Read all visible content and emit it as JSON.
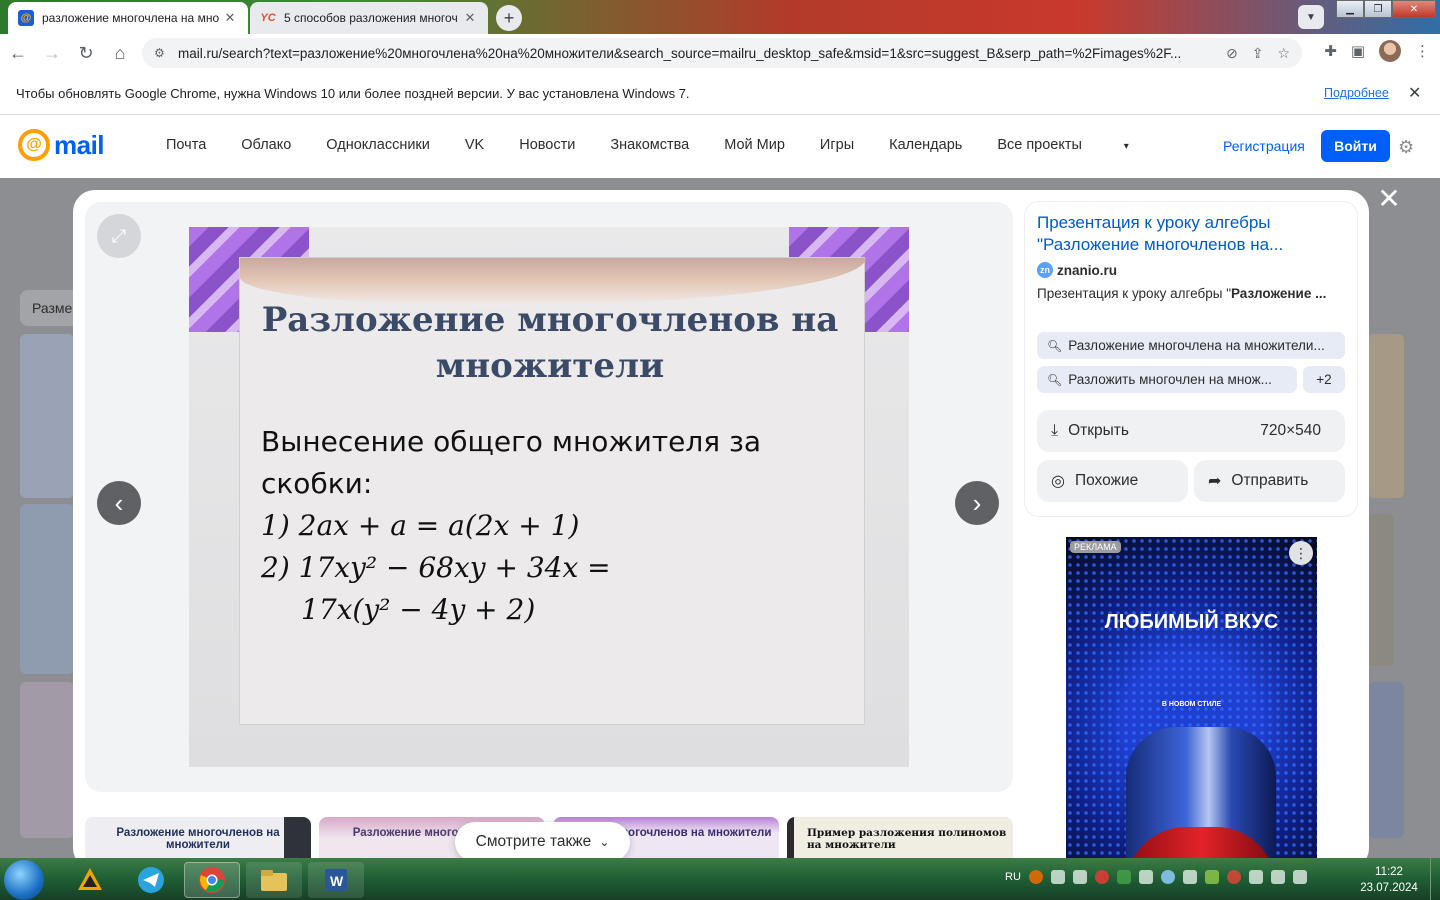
{
  "browser": {
    "tabs": [
      {
        "title": "разложение многочлена на мно",
        "icon": "mailru-at-icon",
        "active": true
      },
      {
        "title": "5 способов разложения многоч",
        "icon": "yaklass-icon",
        "active": false
      }
    ],
    "new_tab": "+",
    "url": "mail.ru/search?text=разложение%20многочлена%20на%20множители&search_source=mailru_desktop_safe&msid=1&src=suggest_B&serp_path=%2Fimages%2F...",
    "infobar_text": "Чтобы обновлять Google Chrome, нужна Windows 10 или более поздней версии. У вас установлена Windows 7.",
    "infobar_link": "Подробнее"
  },
  "mailru_header": {
    "logo_text": "mail",
    "nav": [
      "Почта",
      "Облако",
      "Одноклассники",
      "VK",
      "Новости",
      "Знакомства",
      "Мой Мир",
      "Игры",
      "Календарь",
      "Все проекты"
    ],
    "register": "Регистрация",
    "login": "Войти"
  },
  "background": {
    "filter_label": "Разме"
  },
  "slide": {
    "title": "Разложение многочленов на множители",
    "line1": "Вынесение общего множителя за",
    "line2": "скобки:",
    "item1": "1) 2ax + a = a(2x + 1)",
    "item2": "2) 17xy² − 68xy + 34x =",
    "item2_cont": "17x(y² − 4y + 2)"
  },
  "info_panel": {
    "title": "Презентация к уроку алгебры \"Разложение многочленов на...",
    "source": "znanio.ru",
    "description_prefix": "Презентация к уроку алгебры \"",
    "description_bold": "Разложение ...",
    "chips": [
      "Разложение многочлена на множители...",
      "Разложить многочлен на множ..."
    ],
    "chips_more": "+2",
    "open_label": "Открыть",
    "dimensions": "720×540",
    "similar_label": "Похожие",
    "share_label": "Отправить"
  },
  "ad": {
    "badge": "РЕКЛАМА",
    "headline": "ЛЮБИМЫЙ ВКУС",
    "sub": "В НОВОМ СТИЛЕ"
  },
  "thumbs": [
    {
      "text": "Разложение многочленов на множители"
    },
    {
      "text": "Разложение много множите"
    },
    {
      "text": "ложение многочленов на множители"
    },
    {
      "text": "Пример разложения полиномов на множители"
    }
  ],
  "see_also": "Смотрите также",
  "taskbar": {
    "lang": "RU",
    "time": "11:22",
    "date": "23.07.2024"
  }
}
